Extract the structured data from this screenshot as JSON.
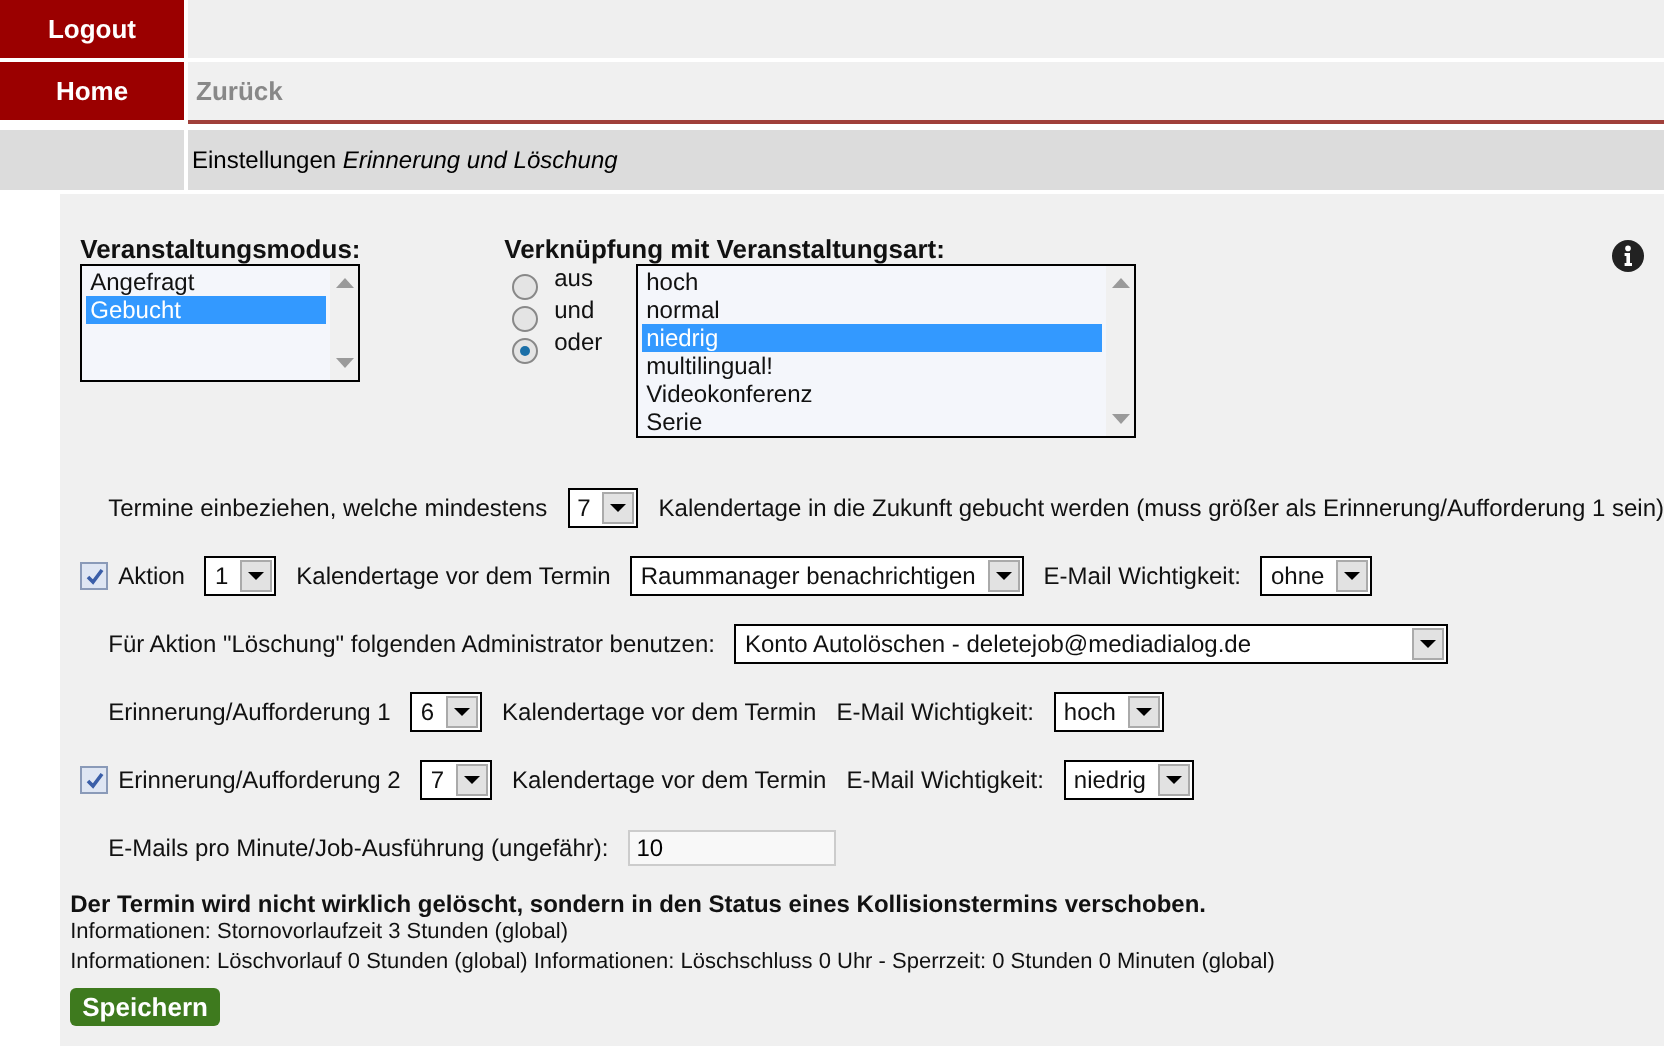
{
  "nav": [
    {
      "label": "Logout"
    },
    {
      "label": "Home"
    }
  ],
  "back_link": "Zurück",
  "heading": "Einstellungen *Erinnerung und Löschung*",
  "mode": {
    "label": "Veranstaltungsmodus:",
    "options": [
      {
        "label": "Angefragt",
        "selected": false
      },
      {
        "label": "Gebucht",
        "selected": true
      }
    ]
  },
  "link": {
    "label": "Verknüpfung mit Veranstaltungsart:",
    "radios": [
      {
        "label": "aus",
        "selected": false
      },
      {
        "label": "und",
        "selected": false
      },
      {
        "label": "oder",
        "selected": true
      }
    ],
    "options": [
      {
        "label": "hoch",
        "selected": false
      },
      {
        "label": "normal",
        "selected": false
      },
      {
        "label": "niedrig",
        "selected": true
      },
      {
        "label": "multilingual!",
        "selected": false
      },
      {
        "label": "Videokonferenz",
        "selected": false
      },
      {
        "label": "Serie",
        "selected": false
      }
    ]
  },
  "rows": [
    {
      "items": [
        {
          "kind": "text",
          "text": "Termine einbeziehen, welche mindestens"
        },
        {
          "kind": "select",
          "value": "7"
        },
        {
          "kind": "text",
          "text": "Kalendertage in die Zukunft gebucht werden (muss größer als Erinnerung/Aufforderung 1 sein)"
        }
      ]
    },
    {
      "items": [
        {
          "kind": "checkbox",
          "checked": true,
          "text": "Aktion"
        },
        {
          "kind": "select",
          "value": "1"
        },
        {
          "kind": "text",
          "text": "Kalendertage vor dem Termin"
        },
        {
          "kind": "select",
          "value": "Raummanager benachrichtigen"
        },
        {
          "kind": "text",
          "text": "E-Mail Wichtigkeit:"
        },
        {
          "kind": "select",
          "value": "ohne"
        }
      ]
    },
    {
      "items": [
        {
          "kind": "text",
          "text": "Für Aktion \"Löschung\" folgenden Administrator benutzen:"
        },
        {
          "kind": "wide-select",
          "value": "Konto Autolöschen - deletejob@mediadialog.de"
        }
      ]
    },
    {
      "items": [
        {
          "kind": "text",
          "text": "Erinnerung/Aufforderung 1"
        },
        {
          "kind": "select",
          "value": "6"
        },
        {
          "kind": "text",
          "text": "Kalendertage vor dem Termin"
        },
        {
          "kind": "text",
          "text": "E-Mail Wichtigkeit:"
        },
        {
          "kind": "select",
          "value": "hoch"
        }
      ]
    },
    {
      "items": [
        {
          "kind": "checkbox",
          "checked": true,
          "text": "Erinnerung/Aufforderung 2"
        },
        {
          "kind": "select",
          "value": "7"
        },
        {
          "kind": "text",
          "text": "Kalendertage vor dem Termin"
        },
        {
          "kind": "text",
          "text": "E-Mail Wichtigkeit:"
        },
        {
          "kind": "select",
          "value": "niedrig"
        }
      ]
    },
    {
      "items": [
        {
          "kind": "text",
          "text": "E-Mails pro Minute/Job-Ausführung (ungefähr):"
        },
        {
          "kind": "input",
          "value": "10"
        }
      ]
    }
  ],
  "notice": "Der Termin wird nicht wirklich gelöscht, sondern in den Status eines Kollisionstermins verschoben.",
  "info_lines": [
    "Informationen: Stornovorlaufzeit 3 Stunden (global)",
    "Informationen: Löschvorlauf 0 Stunden (global)  Informationen: Löschschluss 0 Uhr - Sperrzeit: 0 Stunden 0 Minuten (global)"
  ],
  "save_button": "Speichern"
}
